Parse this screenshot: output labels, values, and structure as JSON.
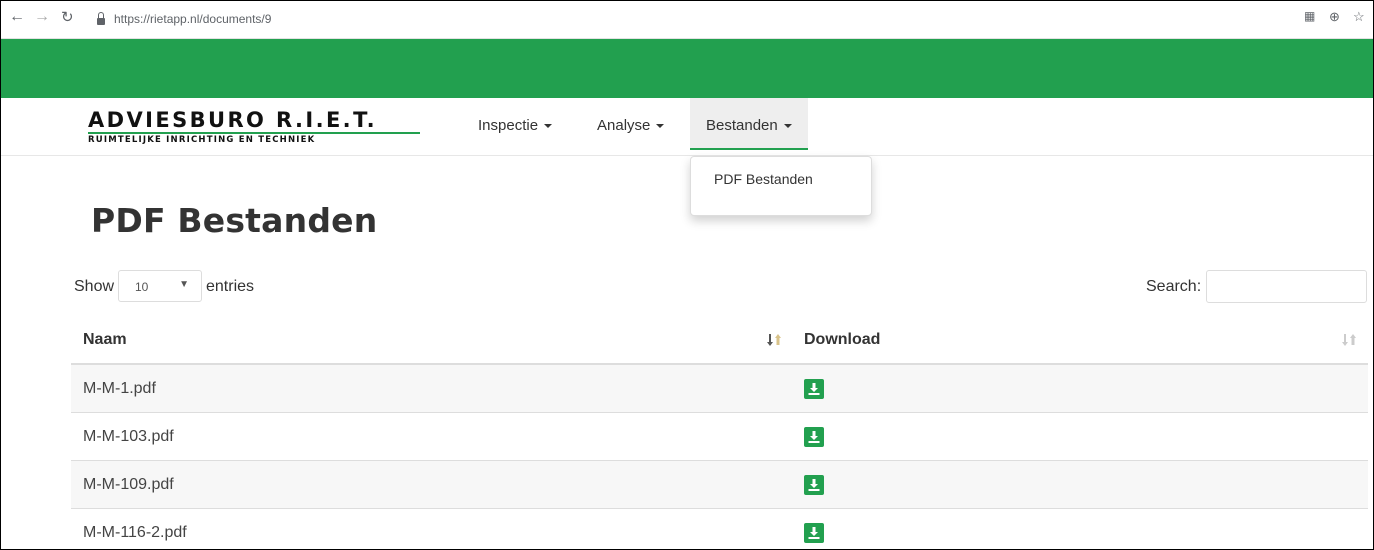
{
  "browser": {
    "url": "https://rietapp.nl/documents/9",
    "back_icon": "back-arrow-icon",
    "forward_icon": "forward-arrow-icon",
    "reload_icon": "reload-icon"
  },
  "brand": {
    "title": "ADVIESBURO R.I.E.T.",
    "subtitle": "RUIMTELIJKE INRICHTING EN TECHNIEK",
    "accent_color": "#22a04f"
  },
  "nav": {
    "items": [
      {
        "label": "Inspectie"
      },
      {
        "label": "Analyse"
      },
      {
        "label": "Bestanden"
      }
    ],
    "active": "Bestanden",
    "dropdown": {
      "items": [
        {
          "label": "PDF Bestanden"
        }
      ]
    }
  },
  "page": {
    "title": "PDF Bestanden"
  },
  "table_controls": {
    "show_label": "Show",
    "page_length": "10",
    "entries_label": "entries",
    "search_label": "Search:",
    "search_value": ""
  },
  "table": {
    "columns": [
      "Naam",
      "Download"
    ],
    "rows": [
      {
        "name": "M-M-1.pdf"
      },
      {
        "name": "M-M-103.pdf"
      },
      {
        "name": "M-M-109.pdf"
      },
      {
        "name": "M-M-116-2.pdf"
      }
    ]
  }
}
